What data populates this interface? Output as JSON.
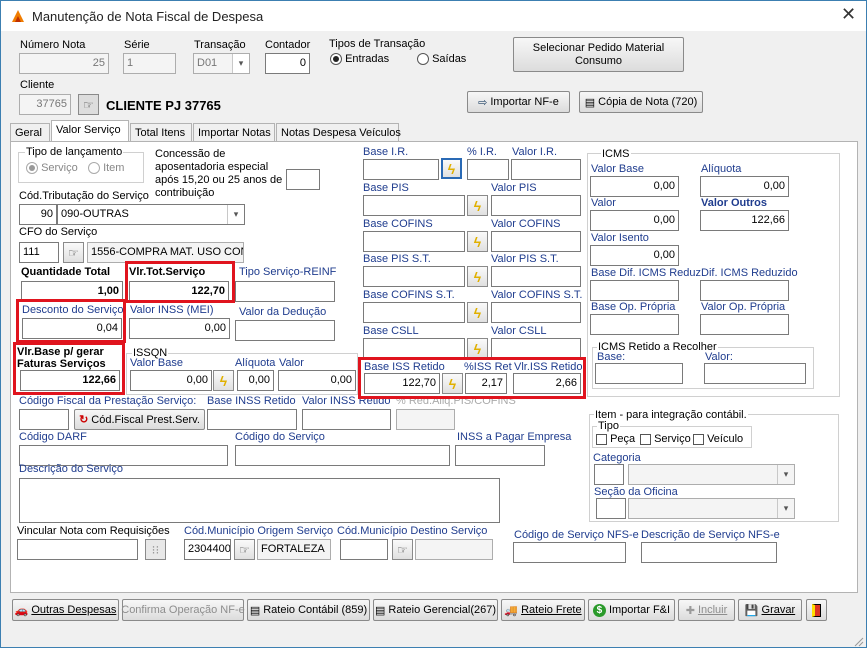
{
  "window": {
    "title": "Manutenção de Nota Fiscal de Despesa",
    "close": "✕"
  },
  "header": {
    "numero_nota_label": "Número Nota",
    "numero_nota": "25",
    "serie_label": "Série",
    "serie": "1",
    "transacao_label": "Transação",
    "transacao": "D01",
    "contador_label": "Contador",
    "contador": "0",
    "tipos_label": "Tipos de Transação",
    "entradas": "Entradas",
    "saidas": "Saídas",
    "selecionar_btn": "Selecionar Pedido Material Consumo",
    "cliente_label": "Cliente",
    "cliente_code": "37765",
    "cliente_name": "CLIENTE PJ 37765",
    "importar_nfe": "Importar NF-e",
    "copia_nota": "Cópia de Nota (720)"
  },
  "tabs": [
    "Geral",
    "Valor Serviço",
    "Total Itens",
    "Importar Notas",
    "Notas Despesa Veículos"
  ],
  "form": {
    "tipo_lanc_label": "Tipo de lançamento",
    "servico": "Serviço",
    "item": "Item",
    "concessao": "Concessão de aposentadoria especial após 15,20 ou 25 anos de contribuição",
    "cod_trib_label": "Cód.Tributação do Serviço",
    "cod_trib_num": "90",
    "cod_trib_text": "090-OUTRAS",
    "cfo_label": "CFO do Serviço",
    "cfo_num": "111",
    "cfo_text": "1556-COMPRA MAT. USO CONSU",
    "qtd_label": "Quantidade Total",
    "qtd": "1,00",
    "vlr_tot_label": "Vlr.Tot.Serviço",
    "vlr_tot": "122,70",
    "tipo_reinf_label": "Tipo Serviço-REINF",
    "desconto_label": "Desconto do Serviço",
    "desconto": "0,04",
    "inss_mei_label": "Valor INSS (MEI)",
    "inss_mei": "0,00",
    "deducao_label": "Valor da Dedução",
    "base_faturas_label": "Vlr.Base p/ gerar Faturas Serviços",
    "base_faturas": "122,66",
    "issqn_label": "ISSQN",
    "issqn_vbase_label": "Valor Base",
    "issqn_vbase": "0,00",
    "issqn_aliq_label": "Alíquota",
    "issqn_aliq": "0,00",
    "issqn_valor_label": "Valor",
    "issqn_valor": "0,00",
    "cod_fiscal_label": "Código Fiscal da Prestação Serviço:",
    "cod_fiscal_btn": "Cód.Fiscal Prest.Serv.",
    "base_inss_ret_label": "Base INSS Retido",
    "valor_inss_ret_label": "Valor INSS Retido",
    "red_aliq_label": "% Red.Aliq.PIS/COFINS",
    "darf_label": "Código DARF",
    "cod_servico_label": "Código do Serviço",
    "inss_pagar_label": "INSS a Pagar Empresa",
    "descricao_label": "Descrição do Serviço",
    "vincular_label": "Vincular Nota com Requisições",
    "mun_origem_label": "Cód.Município Origem Serviço",
    "mun_origem_code": "2304400",
    "mun_origem_name": "FORTALEZA",
    "mun_destino_label": "Cód.Município Destino Serviço",
    "cod_nfse_label": "Código de Serviço NFS-e",
    "desc_nfse_label": "Descrição de Serviço NFS-e"
  },
  "taxes": {
    "base_ir": "Base I.R.",
    "pct_ir": "% I.R.",
    "valor_ir": "Valor I.R.",
    "base_pis": "Base PIS",
    "valor_pis": "Valor PIS",
    "base_cofins": "Base COFINS",
    "valor_cofins": "Valor COFINS",
    "base_pis_st": "Base PIS S.T.",
    "valor_pis_st": "Valor PIS S.T.",
    "base_cofins_st": "Base COFINS S.T.",
    "valor_cofins_st": "Valor COFINS S.T.",
    "base_csll": "Base CSLL",
    "valor_csll": "Valor CSLL",
    "base_iss_ret_label": "Base ISS Retido",
    "base_iss_ret": "122,70",
    "pct_iss_ret_label": "%ISS Ret",
    "pct_iss_ret": "2,17",
    "vlr_iss_ret_label": "Vlr.ISS Retido",
    "vlr_iss_ret": "2,66"
  },
  "icms": {
    "title": "ICMS",
    "valor_base_label": "Valor Base",
    "valor_base": "0,00",
    "aliquota_label": "Alíquota",
    "aliquota": "0,00",
    "valor_label": "Valor",
    "valor": "0,00",
    "valor_outros_label": "Valor Outros",
    "valor_outros": "122,66",
    "valor_isento_label": "Valor Isento",
    "valor_isento": "0,00",
    "base_dif_label": "Base Dif. ICMS Reduz.",
    "dif_red_label": "Dif. ICMS Reduzido",
    "base_op_label": "Base Op. Própria",
    "valor_op_label": "Valor Op. Própria",
    "retido_title": "ICMS Retido a Recolher",
    "retido_base": "Base:",
    "retido_valor": "Valor:"
  },
  "item": {
    "title": "Item - para integração contábil.",
    "tipo": "Tipo",
    "peca": "Peça",
    "servico": "Serviço",
    "veiculo": "Veículo",
    "categoria": "Categoria",
    "secao": "Seção da Oficina"
  },
  "bottom": {
    "outras": "Outras Despesas",
    "confirma": "Confirma Operação NF-e",
    "rateio_contabil": "Rateio Contábil (859)",
    "rateio_gerencial": "Rateio Gerencial(267)",
    "rateio_frete": "Rateio Frete",
    "importar_fi": "Importar F&I",
    "incluir": "Incluir",
    "gravar": "Gravar"
  },
  "colors": {
    "highlight": "#e0141e",
    "label_blue": "#1f3c8e",
    "bolt": "#e0b000"
  }
}
